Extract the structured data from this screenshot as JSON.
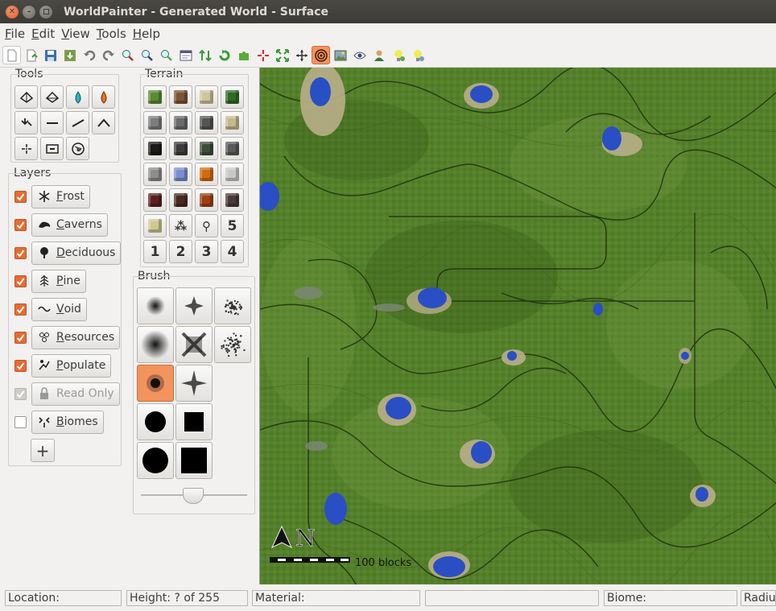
{
  "window": {
    "title": "WorldPainter - Generated World - Surface"
  },
  "menu": [
    {
      "label": "File",
      "u": "F",
      "rest": "ile"
    },
    {
      "label": "Edit",
      "u": "E",
      "rest": "dit"
    },
    {
      "label": "View",
      "u": "V",
      "rest": "iew"
    },
    {
      "label": "Tools",
      "u": "T",
      "rest": "ools"
    },
    {
      "label": "Help",
      "u": "H",
      "rest": "elp"
    }
  ],
  "panels": {
    "tools_label": "Tools",
    "terrain_label": "Terrain",
    "layers_label": "Layers",
    "brush_label": "Brush"
  },
  "terrain": {
    "colors": [
      [
        "#5b8a32",
        "#7a5535",
        "#cfc59a",
        "#2f6b22"
      ],
      [
        "#7d7d7d",
        "#6b6b6b",
        "#555555",
        "#c4b98c"
      ],
      [
        "#1a1a1a",
        "#3d3d3d",
        "#3e4d3a",
        "#5a5a5a"
      ],
      [
        "#8d8d8d",
        "#7b8fd0",
        "#d46a10",
        "#c8c8c8"
      ],
      [
        "#5a2020",
        "#4a2a20",
        "#a04010",
        "#4a3a3a"
      ],
      [
        "#d0c890",
        null,
        null,
        null
      ]
    ],
    "numbers": [
      "5",
      "1",
      "2",
      "3",
      "4"
    ]
  },
  "layers": [
    {
      "label": "Frost",
      "u": "F",
      "rest": "rost",
      "checked": true,
      "icon": "frost-icon"
    },
    {
      "label": "Caverns",
      "u": "C",
      "rest": "averns",
      "checked": true,
      "icon": "caverns-icon"
    },
    {
      "label": "Deciduous",
      "u": "D",
      "rest": "eciduous",
      "checked": true,
      "icon": "tree-icon"
    },
    {
      "label": "Pine",
      "u": "P",
      "rest": "ine",
      "checked": true,
      "icon": "pine-icon"
    },
    {
      "label": "Void",
      "u": "V",
      "rest": "oid",
      "checked": true,
      "icon": "infinity-icon"
    },
    {
      "label": "Resources",
      "u": "R",
      "rest": "esources",
      "checked": true,
      "icon": "resources-icon"
    },
    {
      "label": "Populate",
      "u": "P",
      "rest": "opulate",
      "checked": true,
      "icon": "populate-icon"
    },
    {
      "label": "Read Only",
      "u": "",
      "rest": "Read Only",
      "checked": true,
      "disabled": true,
      "icon": "lock-icon"
    },
    {
      "label": "Biomes",
      "u": "B",
      "rest": "iomes",
      "checked": false,
      "icon": "biomes-icon"
    }
  ],
  "layers_add_label": "+",
  "map": {
    "north_label": "N",
    "scale_label": "100 blocks"
  },
  "status": {
    "location": "Location:",
    "height": "Height: ? of 255",
    "material": "Material:",
    "empty": "",
    "biome": "Biome:",
    "radius": "Radius"
  },
  "colors": {
    "accent": "#f3935e",
    "grass": "#4f7a25",
    "water": "#2a4fc4",
    "sand": "#b9ae8a"
  }
}
